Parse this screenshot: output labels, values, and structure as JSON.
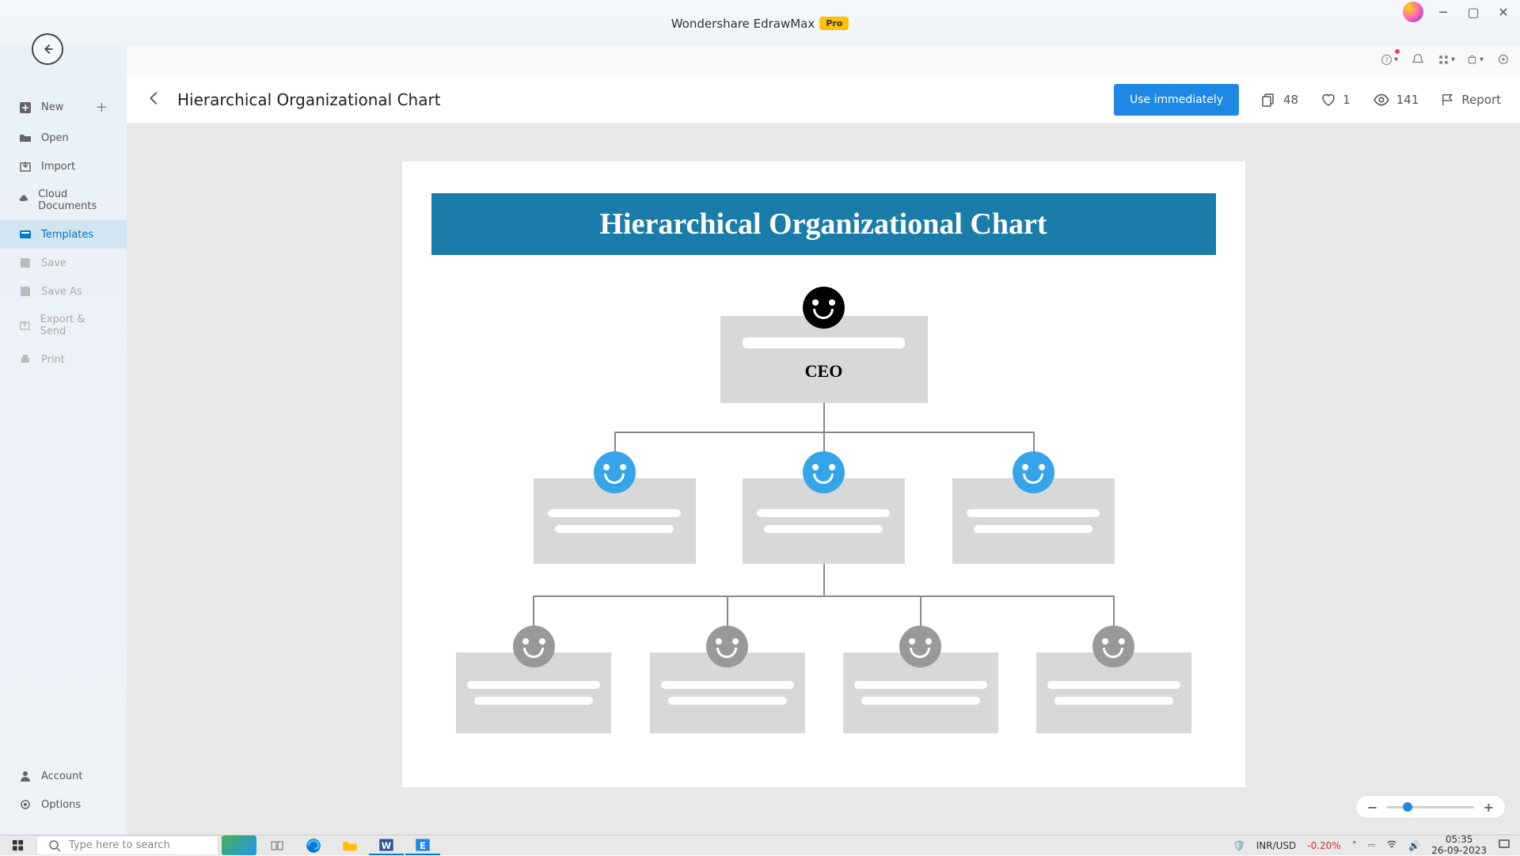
{
  "titlebar": {
    "app": "Wondershare EdrawMax",
    "badge": "Pro"
  },
  "sidebar": {
    "new": "New",
    "open": "Open",
    "import": "Import",
    "cloud": "Cloud Documents",
    "templates": "Templates",
    "save": "Save",
    "saveas": "Save As",
    "export": "Export & Send",
    "print": "Print",
    "account": "Account",
    "options": "Options"
  },
  "header": {
    "title": "Hierarchical Organizational Chart",
    "use": "Use immediately",
    "copies": "48",
    "likes": "1",
    "views": "141",
    "report": "Report"
  },
  "chart": {
    "banner": "Hierarchical Organizational Chart",
    "ceo": "CEO"
  },
  "taskbar": {
    "search": "Type here to search",
    "currency_pair": "INR/USD",
    "currency_change": "-0.20%",
    "time": "05:35",
    "date": "26-09-2023"
  }
}
